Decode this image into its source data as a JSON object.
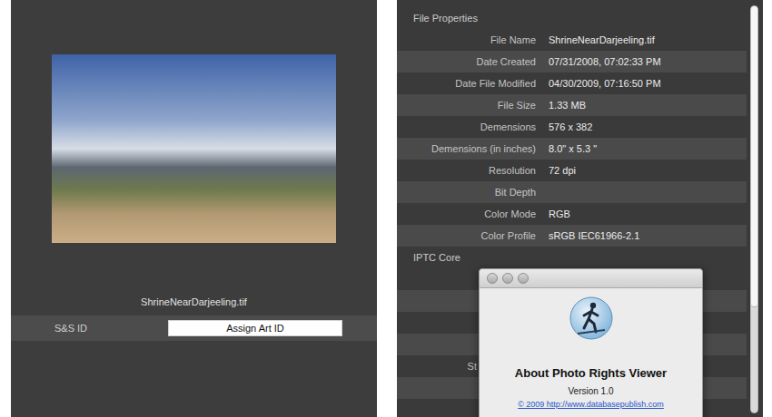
{
  "preview": {
    "caption": "ShrineNearDarjeeling.tif",
    "id_label": "S&S ID",
    "id_button": "Assign Art ID"
  },
  "sections": [
    {
      "title": "File Properties",
      "rows": [
        {
          "label": "File Name",
          "value": "ShrineNearDarjeeling.tif"
        },
        {
          "label": "Date Created",
          "value": "07/31/2008, 07:02:33 PM"
        },
        {
          "label": "Date File Modified",
          "value": "04/30/2009, 07:16:50 PM"
        },
        {
          "label": "File Size",
          "value": "1.33 MB"
        },
        {
          "label": "Demensions",
          "value": "576 x 382"
        },
        {
          "label": "Demensions (in inches)",
          "value": "8.0\" x 5.3 \""
        },
        {
          "label": "Resolution",
          "value": "72 dpi"
        },
        {
          "label": "Bit Depth",
          "value": ""
        },
        {
          "label": "Color Mode",
          "value": "RGB"
        },
        {
          "label": "Color Profile",
          "value": "sRGB IEC61966-2.1"
        }
      ]
    },
    {
      "title": "IPTC Core",
      "rows": [
        {
          "label": "",
          "value": ""
        },
        {
          "label": "",
          "value": ""
        },
        {
          "label": "",
          "value": ""
        },
        {
          "label": "",
          "value": ""
        },
        {
          "label": "St",
          "value": ""
        },
        {
          "label": "",
          "value": ""
        },
        {
          "label": "",
          "value": ""
        }
      ]
    }
  ],
  "scrollbar": {
    "level": 0.74
  },
  "about_dialog": {
    "title": "About Photo Rights Viewer",
    "version": "Version 1.0",
    "link": "© 2009 http://www.databasepublish.com"
  }
}
